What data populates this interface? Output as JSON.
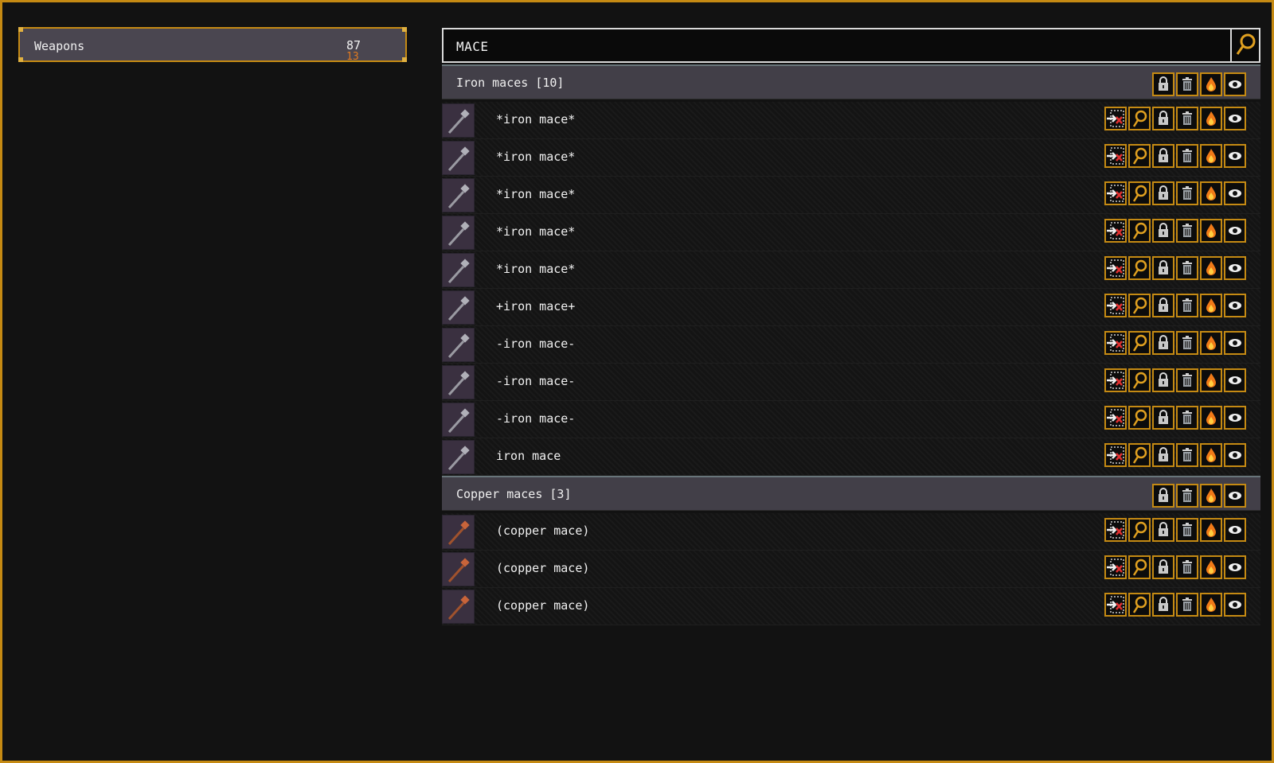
{
  "category": {
    "label": "Weapons",
    "count": "87",
    "sub_count": "13"
  },
  "search": {
    "value": "MACE"
  },
  "groups": [
    {
      "title": "Iron maces [10]",
      "items": [
        {
          "name": "*iron mace*",
          "icon": "iron-mace"
        },
        {
          "name": "*iron mace*",
          "icon": "iron-mace"
        },
        {
          "name": "*iron mace*",
          "icon": "iron-mace"
        },
        {
          "name": "*iron mace*",
          "icon": "iron-mace"
        },
        {
          "name": "*iron mace*",
          "icon": "iron-mace"
        },
        {
          "name": "+iron mace+",
          "icon": "iron-mace"
        },
        {
          "name": "-iron mace-",
          "icon": "iron-mace"
        },
        {
          "name": "-iron mace-",
          "icon": "iron-mace"
        },
        {
          "name": "-iron mace-",
          "icon": "iron-mace"
        },
        {
          "name": "iron mace",
          "icon": "iron-mace"
        }
      ]
    },
    {
      "title": "Copper maces [3]",
      "items": [
        {
          "name": "(copper mace)",
          "icon": "copper-mace"
        },
        {
          "name": "(copper mace)",
          "icon": "copper-mace"
        },
        {
          "name": "(copper mace)",
          "icon": "copper-mace"
        }
      ]
    }
  ],
  "colors": {
    "accent": "#c58a13",
    "sub_count": "#e07a20",
    "flame": "#f07a18",
    "forbid_x": "#e03030"
  },
  "icons": {
    "group_actions": [
      "lock-icon",
      "trash-icon",
      "flame-icon",
      "eye-icon"
    ],
    "item_actions": [
      "forbid-icon",
      "magnify-icon",
      "lock-icon",
      "trash-icon",
      "flame-icon",
      "eye-icon"
    ]
  }
}
